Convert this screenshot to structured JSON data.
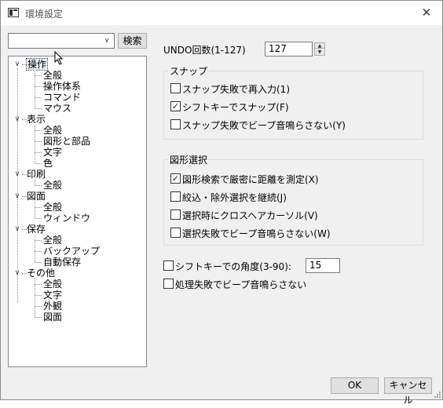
{
  "window": {
    "title": "環境設定",
    "close_glyph": "✕",
    "title_icon": "settings-app-icon"
  },
  "search": {
    "value": "",
    "dropdown_glyph": "∨",
    "button_label": "検索"
  },
  "tree": {
    "expanded_glyph": "∨",
    "groups": [
      {
        "label": "操作",
        "children": [
          "全般",
          "操作体系",
          "コマンド",
          "マウス"
        ]
      },
      {
        "label": "表示",
        "children": [
          "全般",
          "図形と部品",
          "文字",
          "色"
        ]
      },
      {
        "label": "印刷",
        "children": [
          "全般"
        ]
      },
      {
        "label": "図面",
        "children": [
          "全般",
          "ウィンドウ"
        ]
      },
      {
        "label": "保存",
        "children": [
          "全般",
          "バックアップ",
          "自動保存"
        ]
      },
      {
        "label": "その他",
        "children": [
          "全般",
          "文字",
          "外観",
          "図面"
        ]
      }
    ],
    "selected": "操作"
  },
  "undo": {
    "label": "UNDO回数(1-127)",
    "value": "127",
    "spin_up": "▲",
    "spin_down": "▼"
  },
  "snap_group": {
    "title": "スナップ",
    "options": [
      {
        "label": "スナップ失敗で再入力(1)",
        "checked": false
      },
      {
        "label": "シフトキーでスナップ(F)",
        "checked": true
      },
      {
        "label": "スナップ失敗でビープ音鳴らさない(Y)",
        "checked": false
      }
    ]
  },
  "select_group": {
    "title": "図形選択",
    "options": [
      {
        "label": "図形検索で厳密に距離を測定(X)",
        "checked": true
      },
      {
        "label": "絞込・除外選択を継続(J)",
        "checked": false
      },
      {
        "label": "選択時にクロスヘアカーソル(V)",
        "checked": false
      },
      {
        "label": "選択失敗でビープ音鳴らさない(W)",
        "checked": false
      }
    ]
  },
  "angle": {
    "label": "シフトキーでの角度(3-90):",
    "checked": false,
    "value": "15"
  },
  "process_beep": {
    "label": "処理失敗でビープ音鳴らさない",
    "checked": false
  },
  "buttons": {
    "ok": "OK",
    "cancel": "キャンセル"
  },
  "check_glyph": "✓"
}
